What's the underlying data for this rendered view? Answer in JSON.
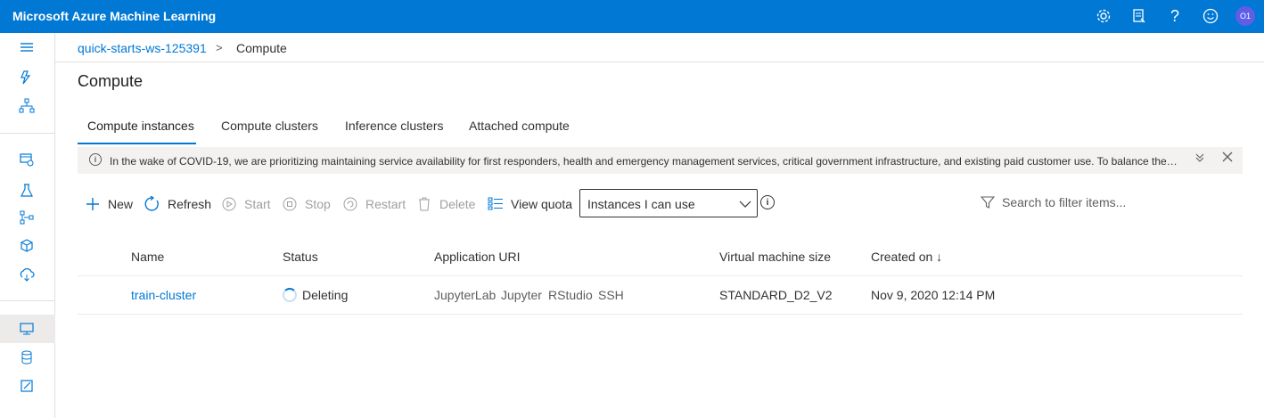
{
  "app": {
    "title": "Microsoft Azure Machine Learning",
    "user_initials": "O1",
    "icons": [
      "gear-icon",
      "feedback-icon",
      "help-icon",
      "smiley-icon"
    ]
  },
  "leftnav": {
    "items": [
      "hamburger-icon",
      "automl-icon",
      "designer-icon",
      "datasets-icon",
      "experiments-icon",
      "pipelines-icon",
      "models-icon",
      "endpoints-icon",
      "compute-icon",
      "datastores-icon",
      "labeling-icon"
    ],
    "selected": "compute-icon"
  },
  "breadcrumb": {
    "workspace": "quick-starts-ws-125391",
    "separator": ">",
    "current": "Compute"
  },
  "page": {
    "title": "Compute"
  },
  "tabs": [
    {
      "label": "Compute instances",
      "active": true
    },
    {
      "label": "Compute clusters",
      "active": false
    },
    {
      "label": "Inference clusters",
      "active": false
    },
    {
      "label": "Attached compute",
      "active": false
    }
  ],
  "banner": {
    "message": "In the wake of COVID-19, we are prioritizing maintaining service availability for first responders, health and emergency management services, critical government infrastructure, and existing paid customer use. To balance the b…",
    "expand": "⌄⌄",
    "close": "✕"
  },
  "toolbar": {
    "new": "New",
    "refresh": "Refresh",
    "start": "Start",
    "stop": "Stop",
    "restart": "Restart",
    "delete": "Delete",
    "view_quota": "View quota",
    "filter_selected": "Instances I can use",
    "search_placeholder": "Search to filter items..."
  },
  "table": {
    "columns": [
      "Name",
      "Status",
      "Application URI",
      "Virtual machine size",
      "Created on ↓"
    ],
    "rows": [
      {
        "name": "train-cluster",
        "status": "Deleting",
        "uris": [
          "JupyterLab",
          "Jupyter",
          "RStudio",
          "SSH"
        ],
        "vm_size": "STANDARD_D2_V2",
        "created": "Nov 9, 2020 12:14 PM"
      }
    ]
  },
  "colors": {
    "brand": "#0078d4",
    "link": "#0078d4",
    "disabled": "#a19f9d"
  }
}
